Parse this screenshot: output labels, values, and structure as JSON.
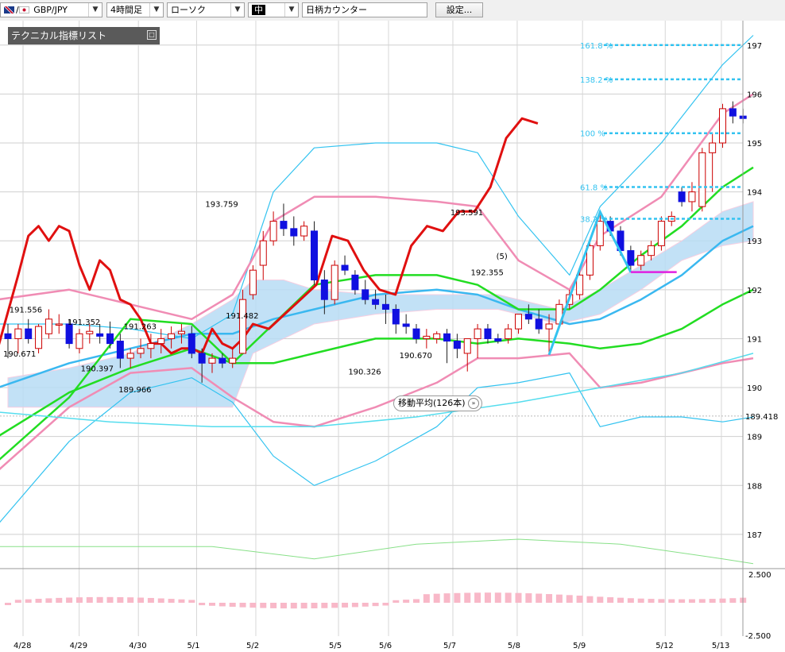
{
  "toolbar": {
    "pair": "GBP/JPY",
    "timeframe": "4時間足",
    "chart_style": "ローソク",
    "size": "中",
    "counter": "日柄カウンター",
    "settings": "設定..."
  },
  "indicator_panel": {
    "label": "テクニカル指標リスト",
    "button": "□"
  },
  "ma_popup": {
    "label": "移動平均(126本)",
    "button": "»"
  },
  "colors": {
    "up_candle": "#cc0000",
    "down_candle": "#1010e0",
    "rsi_line": "#e01010",
    "bollinger_outer": "#33c3f0",
    "bollinger_inner": "#f08cb4",
    "ma_short": "#3ab8f0",
    "ma_mid": "#22dd22",
    "fibonacci": "#33c3f0",
    "cloud_blue": "#b8dcf5",
    "cloud_pink": "#f6c6dc"
  },
  "chart_data": {
    "type": "line",
    "title": "",
    "xlabel": "",
    "ylabel": "",
    "ylim": [
      186.3,
      197.5
    ],
    "grid": true,
    "x_ticks": [
      "4/28",
      "4/29",
      "4/30",
      "5/1",
      "5/2",
      "5/5",
      "5/6",
      "5/7",
      "5/8",
      "5/9",
      "5/12",
      "5/13"
    ],
    "y_ticks": [
      "187",
      "188",
      "189",
      "190",
      "191",
      "192",
      "193",
      "194",
      "195",
      "196",
      "197"
    ],
    "current_price": "189.418",
    "annotations": [
      {
        "text": "191.556",
        "x": 1.3,
        "y": 191.6
      },
      {
        "text": "190.671",
        "x": 0.7,
        "y": 190.7
      },
      {
        "text": "191.352",
        "x": 7.0,
        "y": 191.35
      },
      {
        "text": "190.397",
        "x": 8.3,
        "y": 190.4
      },
      {
        "text": "191.263",
        "x": 12.5,
        "y": 191.26
      },
      {
        "text": "189.966",
        "x": 12.0,
        "y": 189.97
      },
      {
        "text": "193.759",
        "x": 20.5,
        "y": 193.76
      },
      {
        "text": "191.482",
        "x": 22.5,
        "y": 191.48
      },
      {
        "text": "190.326",
        "x": 34.5,
        "y": 190.33
      },
      {
        "text": "190.670",
        "x": 39.5,
        "y": 190.67
      },
      {
        "text": "193.591",
        "x": 44.5,
        "y": 193.59
      },
      {
        "text": "192.355",
        "x": 46.5,
        "y": 192.36
      },
      {
        "text": "(5)",
        "x": 49.0,
        "y": 192.6
      }
    ],
    "fibonacci": [
      {
        "label": "161.8 %",
        "y": 197.0
      },
      {
        "label": "138.2 %",
        "y": 196.3
      },
      {
        "label": "100 %",
        "y": 195.2
      },
      {
        "label": "61.8 %",
        "y": 194.1
      },
      {
        "label": "38.2 %",
        "y": 193.45
      }
    ],
    "candles": [
      {
        "x": 0,
        "o": 191.1,
        "h": 191.3,
        "l": 190.6,
        "c": 191.0
      },
      {
        "x": 1,
        "o": 191.0,
        "h": 191.3,
        "l": 190.7,
        "c": 191.2
      },
      {
        "x": 2,
        "o": 191.2,
        "h": 191.4,
        "l": 190.9,
        "c": 191.0
      },
      {
        "x": 3,
        "o": 190.8,
        "h": 191.3,
        "l": 190.7,
        "c": 191.25
      },
      {
        "x": 4,
        "o": 191.1,
        "h": 191.6,
        "l": 191.0,
        "c": 191.4
      },
      {
        "x": 5,
        "o": 191.3,
        "h": 191.5,
        "l": 191.1,
        "c": 191.3
      },
      {
        "x": 6,
        "o": 191.3,
        "h": 191.4,
        "l": 190.8,
        "c": 190.9
      },
      {
        "x": 7,
        "o": 190.8,
        "h": 191.2,
        "l": 190.7,
        "c": 191.1
      },
      {
        "x": 8,
        "o": 191.1,
        "h": 191.3,
        "l": 190.9,
        "c": 191.15
      },
      {
        "x": 9,
        "o": 191.1,
        "h": 191.3,
        "l": 190.9,
        "c": 191.05
      },
      {
        "x": 10,
        "o": 191.1,
        "h": 191.35,
        "l": 190.8,
        "c": 190.9
      },
      {
        "x": 11,
        "o": 190.95,
        "h": 191.1,
        "l": 190.4,
        "c": 190.6
      },
      {
        "x": 12,
        "o": 190.6,
        "h": 190.8,
        "l": 190.4,
        "c": 190.7
      },
      {
        "x": 13,
        "o": 190.7,
        "h": 191.0,
        "l": 190.6,
        "c": 190.8
      },
      {
        "x": 14,
        "o": 190.8,
        "h": 191.1,
        "l": 190.6,
        "c": 190.9
      },
      {
        "x": 15,
        "o": 190.9,
        "h": 191.2,
        "l": 190.7,
        "c": 191.0
      },
      {
        "x": 16,
        "o": 191.0,
        "h": 191.25,
        "l": 190.8,
        "c": 191.1
      },
      {
        "x": 17,
        "o": 191.1,
        "h": 191.3,
        "l": 190.9,
        "c": 191.15
      },
      {
        "x": 18,
        "o": 191.1,
        "h": 191.26,
        "l": 190.6,
        "c": 190.7
      },
      {
        "x": 19,
        "o": 190.7,
        "h": 190.8,
        "l": 190.1,
        "c": 190.5
      },
      {
        "x": 20,
        "o": 190.5,
        "h": 190.7,
        "l": 190.3,
        "c": 190.6
      },
      {
        "x": 21,
        "o": 190.6,
        "h": 190.7,
        "l": 190.4,
        "c": 190.5
      },
      {
        "x": 22,
        "o": 190.5,
        "h": 190.8,
        "l": 190.4,
        "c": 190.6
      },
      {
        "x": 23,
        "o": 190.7,
        "h": 192.0,
        "l": 190.7,
        "c": 191.8
      },
      {
        "x": 24,
        "o": 191.9,
        "h": 192.5,
        "l": 191.8,
        "c": 192.4
      },
      {
        "x": 25,
        "o": 192.5,
        "h": 193.2,
        "l": 192.2,
        "c": 193.0
      },
      {
        "x": 26,
        "o": 193.0,
        "h": 193.6,
        "l": 192.9,
        "c": 193.4
      },
      {
        "x": 27,
        "o": 193.4,
        "h": 193.76,
        "l": 193.1,
        "c": 193.25
      },
      {
        "x": 28,
        "o": 193.25,
        "h": 193.5,
        "l": 192.9,
        "c": 193.1
      },
      {
        "x": 29,
        "o": 193.1,
        "h": 193.4,
        "l": 193.0,
        "c": 193.3
      },
      {
        "x": 30,
        "o": 193.2,
        "h": 193.4,
        "l": 192.1,
        "c": 192.2
      },
      {
        "x": 31,
        "o": 192.2,
        "h": 192.4,
        "l": 191.5,
        "c": 191.8
      },
      {
        "x": 32,
        "o": 191.8,
        "h": 192.6,
        "l": 191.7,
        "c": 192.5
      },
      {
        "x": 33,
        "o": 192.5,
        "h": 192.7,
        "l": 192.3,
        "c": 192.4
      },
      {
        "x": 34,
        "o": 192.3,
        "h": 192.4,
        "l": 191.9,
        "c": 192.0
      },
      {
        "x": 35,
        "o": 192.0,
        "h": 192.2,
        "l": 191.7,
        "c": 191.8
      },
      {
        "x": 36,
        "o": 191.8,
        "h": 192.0,
        "l": 191.6,
        "c": 191.7
      },
      {
        "x": 37,
        "o": 191.7,
        "h": 191.9,
        "l": 191.3,
        "c": 191.6
      },
      {
        "x": 38,
        "o": 191.6,
        "h": 191.7,
        "l": 191.1,
        "c": 191.3
      },
      {
        "x": 39,
        "o": 191.3,
        "h": 191.5,
        "l": 191.1,
        "c": 191.25
      },
      {
        "x": 40,
        "o": 191.2,
        "h": 191.3,
        "l": 190.9,
        "c": 191.0
      },
      {
        "x": 41,
        "o": 191.0,
        "h": 191.2,
        "l": 190.8,
        "c": 191.05
      },
      {
        "x": 42,
        "o": 191.0,
        "h": 191.15,
        "l": 190.9,
        "c": 191.1
      },
      {
        "x": 43,
        "o": 191.1,
        "h": 191.2,
        "l": 190.5,
        "c": 190.95
      },
      {
        "x": 44,
        "o": 190.95,
        "h": 191.1,
        "l": 190.6,
        "c": 190.8
      },
      {
        "x": 45,
        "o": 190.7,
        "h": 191.0,
        "l": 190.33,
        "c": 191.0
      },
      {
        "x": 46,
        "o": 191.0,
        "h": 191.3,
        "l": 190.6,
        "c": 191.2
      },
      {
        "x": 47,
        "o": 191.2,
        "h": 191.3,
        "l": 190.9,
        "c": 191.0
      },
      {
        "x": 48,
        "o": 191.0,
        "h": 191.1,
        "l": 190.9,
        "c": 190.95
      },
      {
        "x": 49,
        "o": 191.0,
        "h": 191.3,
        "l": 190.9,
        "c": 191.2
      },
      {
        "x": 50,
        "o": 191.2,
        "h": 191.5,
        "l": 191.1,
        "c": 191.5
      },
      {
        "x": 51,
        "o": 191.5,
        "h": 191.7,
        "l": 191.3,
        "c": 191.4
      },
      {
        "x": 52,
        "o": 191.4,
        "h": 191.6,
        "l": 191.1,
        "c": 191.2
      },
      {
        "x": 53,
        "o": 191.2,
        "h": 191.5,
        "l": 190.67,
        "c": 191.3
      },
      {
        "x": 54,
        "o": 191.3,
        "h": 191.8,
        "l": 191.2,
        "c": 191.7
      },
      {
        "x": 55,
        "o": 191.7,
        "h": 192.0,
        "l": 191.6,
        "c": 191.9
      },
      {
        "x": 56,
        "o": 191.9,
        "h": 192.4,
        "l": 191.8,
        "c": 192.3
      },
      {
        "x": 57,
        "o": 192.3,
        "h": 193.0,
        "l": 192.2,
        "c": 192.9
      },
      {
        "x": 58,
        "o": 192.9,
        "h": 193.59,
        "l": 192.8,
        "c": 193.4
      },
      {
        "x": 59,
        "o": 193.4,
        "h": 193.5,
        "l": 193.1,
        "c": 193.2
      },
      {
        "x": 60,
        "o": 193.2,
        "h": 193.3,
        "l": 192.7,
        "c": 192.8
      },
      {
        "x": 61,
        "o": 192.8,
        "h": 192.9,
        "l": 192.36,
        "c": 192.5
      },
      {
        "x": 62,
        "o": 192.5,
        "h": 192.8,
        "l": 192.4,
        "c": 192.7
      },
      {
        "x": 63,
        "o": 192.7,
        "h": 193.0,
        "l": 192.6,
        "c": 192.9
      },
      {
        "x": 64,
        "o": 192.9,
        "h": 193.5,
        "l": 192.8,
        "c": 193.4
      },
      {
        "x": 65,
        "o": 193.4,
        "h": 193.6,
        "l": 193.3,
        "c": 193.5
      },
      {
        "x": 66,
        "o": 194.0,
        "h": 194.1,
        "l": 193.7,
        "c": 193.8
      },
      {
        "x": 67,
        "o": 193.8,
        "h": 194.2,
        "l": 193.6,
        "c": 194.0
      },
      {
        "x": 68,
        "o": 193.7,
        "h": 194.9,
        "l": 193.6,
        "c": 194.8
      },
      {
        "x": 69,
        "o": 194.8,
        "h": 195.2,
        "l": 194.0,
        "c": 195.0
      },
      {
        "x": 70,
        "o": 195.0,
        "h": 195.8,
        "l": 194.9,
        "c": 195.7
      },
      {
        "x": 71,
        "o": 195.7,
        "h": 195.85,
        "l": 195.4,
        "c": 195.55
      },
      {
        "x": 72,
        "o": 195.55,
        "h": 195.7,
        "l": 195.4,
        "c": 195.5
      }
    ]
  }
}
